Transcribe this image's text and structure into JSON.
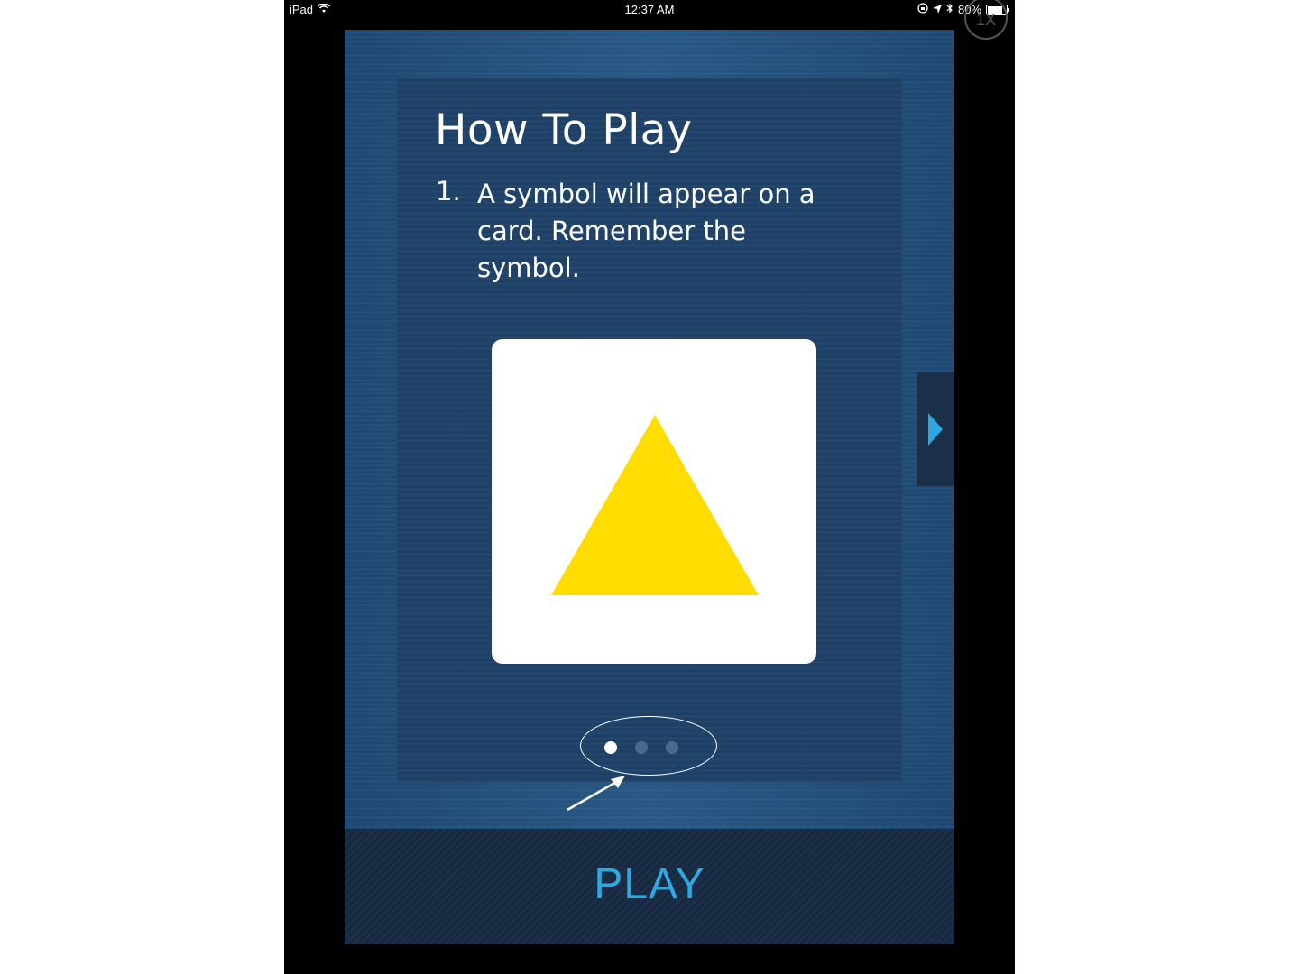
{
  "status_bar": {
    "device": "iPad",
    "time": "12:37 AM",
    "battery": "80%"
  },
  "zoom_badge": "1X",
  "how_to_play": {
    "title": "How To Play",
    "step_number": "1.",
    "step_text": "A symbol will appear on a card. Remember the symbol."
  },
  "card": {
    "symbol_icon": "triangle-icon",
    "symbol_color": "#FFDD00"
  },
  "pagination": {
    "pages": 3,
    "active": 1
  },
  "next_tab": {
    "icon": "chevron-right-icon",
    "color": "#2EA8E0"
  },
  "play_button": {
    "label": "PLAY",
    "color": "#2EA8E0"
  }
}
